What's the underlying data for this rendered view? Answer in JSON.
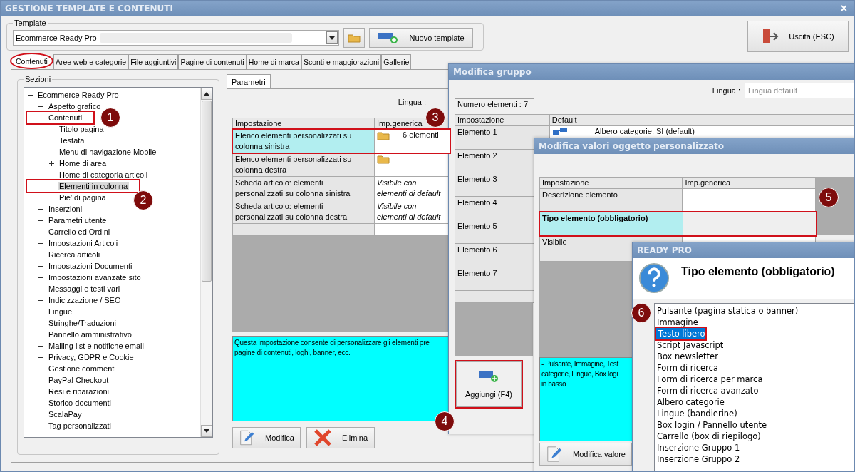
{
  "window": {
    "title": "GESTIONE TEMPLATE E CONTENUTI",
    "close": "×"
  },
  "template": {
    "legend": "Template",
    "value": "Ecommerce Ready Pro",
    "new_button": "Nuovo template"
  },
  "exit_button": "Uscita (ESC)",
  "tabs": [
    {
      "label": "Contenuti",
      "selected": true,
      "highlighted": true
    },
    {
      "label": "Aree web e categorie",
      "selected": false,
      "highlighted": false
    },
    {
      "label": "File aggiuntivi",
      "selected": false,
      "highlighted": false
    },
    {
      "label": "Pagine di contenuti",
      "selected": false,
      "highlighted": false
    },
    {
      "label": "Home di marca",
      "selected": false,
      "highlighted": false
    },
    {
      "label": "Sconti e maggiorazioni",
      "selected": false,
      "highlighted": false
    },
    {
      "label": "Gallerie",
      "selected": false,
      "highlighted": false
    }
  ],
  "sections": {
    "legend": "Sezioni",
    "tree": [
      {
        "label": "Ecommerce Ready Pro",
        "expanded": true,
        "selected": false,
        "children": [
          {
            "label": "Aspetto grafico",
            "expanded": false,
            "selected": false
          },
          {
            "label": "Contenuti",
            "expanded": true,
            "selected": false,
            "highlighted": true,
            "children": [
              {
                "label": "Titolo pagina",
                "selected": false
              },
              {
                "label": "Testata",
                "selected": false
              },
              {
                "label": "Menu di navigazione Mobile",
                "selected": false
              },
              {
                "label": "Home di area",
                "expanded": false,
                "selected": false
              },
              {
                "label": "Home di categoria articoli",
                "selected": false
              },
              {
                "label": "Elementi in colonna",
                "selected": true,
                "highlighted": true
              },
              {
                "label": "Pie' di pagina",
                "selected": false
              }
            ]
          },
          {
            "label": "Inserzioni",
            "expanded": false,
            "selected": false
          },
          {
            "label": "Parametri utente",
            "expanded": false,
            "selected": false
          },
          {
            "label": "Carrello ed Ordini",
            "expanded": false,
            "selected": false
          },
          {
            "label": "Impostazioni Articoli",
            "expanded": false,
            "selected": false
          },
          {
            "label": "Ricerca articoli",
            "expanded": false,
            "selected": false
          },
          {
            "label": "Impostazioni Documenti",
            "expanded": false,
            "selected": false
          },
          {
            "label": "Impostazioni avanzate sito",
            "expanded": false,
            "selected": false
          },
          {
            "label": "Messaggi e testi vari",
            "selected": false
          },
          {
            "label": "Indicizzazione / SEO",
            "expanded": false,
            "selected": false
          },
          {
            "label": "Lingue",
            "selected": false
          },
          {
            "label": "Stringhe/Traduzioni",
            "selected": false
          },
          {
            "label": "Pannello amministrativo",
            "selected": false
          },
          {
            "label": "Mailing list e notifiche email",
            "expanded": false,
            "selected": false
          },
          {
            "label": "Privacy, GDPR e Cookie",
            "expanded": false,
            "selected": false
          },
          {
            "label": "Gestione commenti",
            "expanded": false,
            "selected": false
          },
          {
            "label": "PayPal Checkout",
            "selected": false
          },
          {
            "label": "Resi e riparazioni",
            "selected": false
          },
          {
            "label": "Storico documenti",
            "selected": false
          },
          {
            "label": "ScalaPay",
            "selected": false
          },
          {
            "label": "Tag personalizzati",
            "selected": false
          }
        ]
      }
    ]
  },
  "parameters": {
    "tab": "Parametri",
    "language_label": "Lingua :",
    "columns": [
      "Impostazione",
      "Imp.generica"
    ],
    "rows": [
      {
        "setting": "Elenco elementi personalizzati su colonna sinistra",
        "kind": "folder",
        "value": "6 elementi",
        "selected": true,
        "highlighted": true
      },
      {
        "setting": "Elenco elementi personalizzati su colonna destra",
        "kind": "folder",
        "selected": false
      },
      {
        "setting": "Scheda articolo: elementi personalizzati su colonna sinistra",
        "kind": "text",
        "value": "Visibile con elementi di default",
        "selected": false
      },
      {
        "setting": "Scheda articolo: elementi personalizzati su colonna destra",
        "kind": "text",
        "value": "Visibile con elementi di default",
        "selected": false
      }
    ],
    "description": "Questa impostazione consente di personalizzare gli elementi pre\npagine di contenuti, loghi, banner, ecc.",
    "buttons": [
      {
        "label": "Modifica",
        "kind": "edit"
      },
      {
        "label": "Elimina",
        "kind": "delete"
      }
    ]
  },
  "group_dialog": {
    "title": "Modifica gruppo",
    "language_label": "Lingua :",
    "language_placeholder": "Lingua default",
    "count": "Numero elementi : 7",
    "columns": [
      "Impostazione",
      "Default"
    ],
    "rows": [
      {
        "name": "Elemento 1",
        "value": "Albero categorie, SI (default)"
      },
      {
        "name": "Elemento 2"
      },
      {
        "name": "Elemento 3"
      },
      {
        "name": "Elemento 4"
      },
      {
        "name": "Elemento 5"
      },
      {
        "name": "Elemento 6"
      },
      {
        "name": "Elemento 7"
      }
    ],
    "add_button": {
      "label": "Aggiungi (F4)",
      "highlighted": true
    }
  },
  "values_dialog": {
    "title": "Modifica valori oggetto personalizzato",
    "columns": [
      "Impostazione",
      "Imp.generica"
    ],
    "rows": [
      {
        "name": "Descrizione elemento",
        "selected": false
      },
      {
        "name": "Tipo elemento (obbligatorio)",
        "selected": true,
        "highlighted": true
      },
      {
        "name": "Visibile",
        "selected": false
      }
    ],
    "description": "- Pulsante, Immagine, Test\ncategorie, Lingue, Box logi\nin basso",
    "edit_button": "Modifica valore"
  },
  "ready_dialog": {
    "title": "READY PRO",
    "heading": "Tipo elemento (obbligatorio)",
    "options": [
      {
        "label": "Pulsante (pagina statica o banner)",
        "selected": false
      },
      {
        "label": "Immagine",
        "selected": false
      },
      {
        "label": "Testo libero",
        "selected": true,
        "highlighted": true
      },
      {
        "label": "Script Javascript",
        "selected": false
      },
      {
        "label": "Box newsletter",
        "selected": false
      },
      {
        "label": "Form di ricerca",
        "selected": false
      },
      {
        "label": "Form di ricerca per marca",
        "selected": false
      },
      {
        "label": "Form di ricerca avanzato",
        "selected": false
      },
      {
        "label": "Albero categorie",
        "selected": false
      },
      {
        "label": "Lingue (bandierine)",
        "selected": false
      },
      {
        "label": "Box login / Pannello utente",
        "selected": false
      },
      {
        "label": "Carrello (box di riepilogo)",
        "selected": false
      },
      {
        "label": "Inserzione Gruppo 1",
        "selected": false
      },
      {
        "label": "Inserzione Gruppo 2",
        "selected": false
      }
    ]
  },
  "callouts": [
    "1",
    "2",
    "3",
    "4",
    "5",
    "6"
  ]
}
